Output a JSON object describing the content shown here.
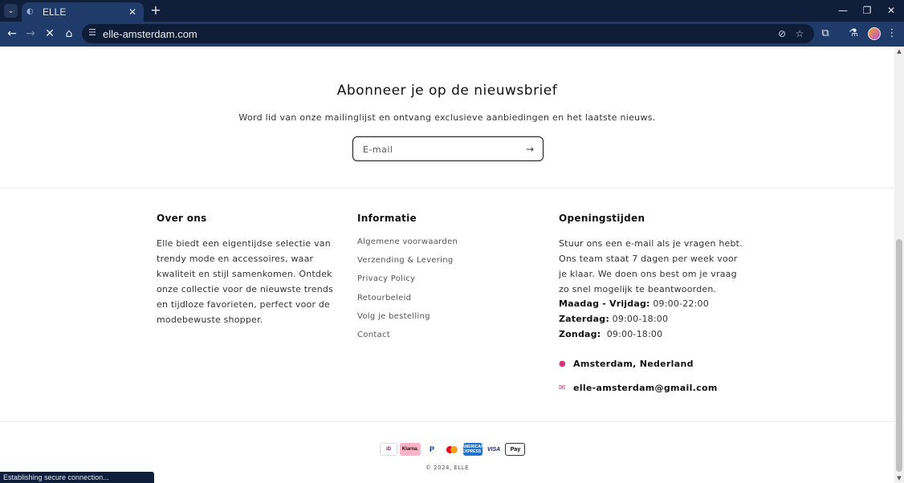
{
  "browser": {
    "tab_title": "ELLE",
    "url": "elle-amsterdam.com",
    "status_text": "Establishing secure connection..."
  },
  "newsletter": {
    "title": "Abonneer je op de nieuwsbrief",
    "subtitle": "Word lid van onze mailinglijst en ontvang exclusieve aanbiedingen en het laatste nieuws.",
    "email_placeholder": "E-mail"
  },
  "footer": {
    "about": {
      "title": "Over ons",
      "text": "Elle biedt een eigentijdse selectie van trendy mode en accessoires, waar kwaliteit en stijl samenkomen. Ontdek onze collectie voor de nieuwste trends en tijdloze favorieten, perfect voor de modebewuste shopper."
    },
    "info": {
      "title": "Informatie",
      "links": [
        "Algemene voorwaarden",
        "Verzending & Levering",
        "Privacy Policy",
        "Retourbeleid",
        "Volg je bestelling",
        "Contact"
      ]
    },
    "hours": {
      "title": "Openingstijden",
      "intro": "Stuur ons een e-mail als je vragen hebt. Ons team staat 7 dagen per week voor je klaar. We doen ons best om je vraag zo snel mogelijk te beantwoorden.",
      "days": [
        {
          "day": "Maadag - Vrijdag:",
          "time": " 09:00-22:00"
        },
        {
          "day": "Zaterdag:",
          "time": " 09:00-18:00"
        },
        {
          "day": "Zondag:",
          "time": "  09:00-18:00"
        }
      ],
      "location": "Amsterdam, Nederland",
      "email": "elle-amsterdam@gmail.com"
    },
    "payments": {
      "ideal": "iD",
      "klarna": "Klarna.",
      "paypal": "P",
      "amex": "AMERICAN EXPRESS",
      "visa": "VISA",
      "apple_pay": "Pay"
    },
    "copyright": "© 2024, ELLE"
  }
}
